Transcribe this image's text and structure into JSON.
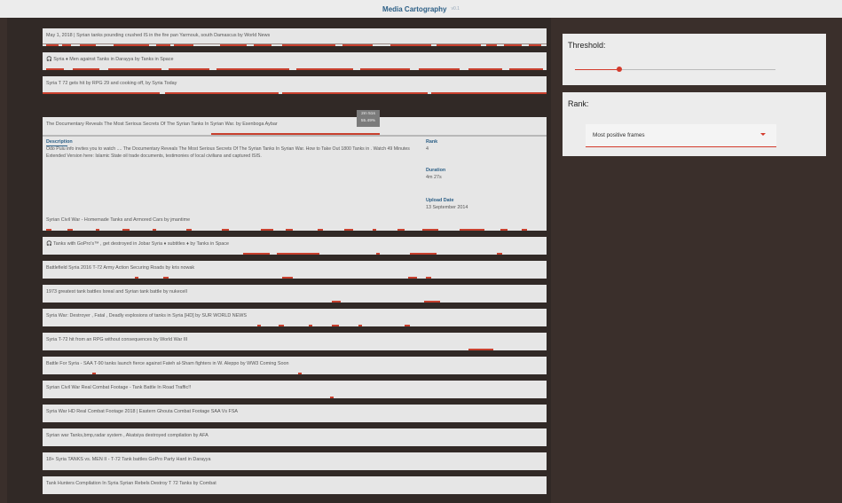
{
  "app": {
    "title": "Media Cartography",
    "version": "v0.1"
  },
  "colors": {
    "accent": "#d33a2c",
    "link": "#2c5f86",
    "background": "#3a2f2b"
  },
  "videos": [
    {
      "title": "May 1, 2018 | Syrian tanks pounding crushed IS in the fire pan Yarmouk, south Damascus by World News"
    },
    {
      "title": "🎧 Syria ♦ Men against Tanks in Darayya by Tanks in Space"
    },
    {
      "title": "Syria T 72 gets hit by RPG 29 and cooking off, by Syria Today"
    },
    {
      "title": "Syrian Civil War - Homemade Tanks and Armored Cars by jmantime"
    },
    {
      "title": "🎧 Tanks with GoPro's™ , get destroyed in Jobar Syria ♦ subtitles ♦ by Tanks in Space"
    },
    {
      "title": "Battlefield Syria 2016 T-72 Army Action Securing Roads by kris nowak"
    },
    {
      "title": "1973 greatest tank battles Isreal and Syrian tank battle by nukecell"
    },
    {
      "title": "Syria War: Destroyer , Fatal , Deadly explosions of tanks in Syria [HD] by SUR WORLD NEWS"
    },
    {
      "title": "Syria T-72 hit from an RPG without consequences by World War III"
    },
    {
      "title": "Battle For Syria - SAA T-90 tanks launch fierce against Fateh al-Sham fighters in W. Aleppo by WW3 Coming Soon"
    },
    {
      "title": "Syrian Civil War Real Combat Footage - Tank Battle In Road Traffic!!"
    },
    {
      "title": "Syria War HD Real Combat Footage 2018 | Eastern Ghouta Combat Footage SAA Vs FSA"
    },
    {
      "title": "Syrian war Tanks,bmp,radar system , Akatsiya destroyed compilation by AFA"
    },
    {
      "title": "18+ Syria TANKS vs. MEN II - T-72 Tank battles GoPro Party Hard in Darayya"
    },
    {
      "title": "Tank Hunters Compilation In Syria Syrian Rebels Destroy T 72 Tanks by Combat"
    }
  ],
  "expanded": {
    "title": "The Documentary Reveals The Most Serious Secrets Of The Syrian Tanks In Syrian War. by Esenboga Aybar",
    "tooltip_time": "2m 51s",
    "tooltip_percent": "55.49%",
    "progress": 0.5549,
    "description_label": "Description",
    "description": "Odo Puiu info invites you to watch .... The Documentary Reveals The Most Serious Secrets Of The Syrian Tanks In Syrian War. How to Take Out 1800 Tanks in . Watch 49 Minutes Extended Version here: Islamic State oil trade documents, testimonies of local civilians and captured ISIS.",
    "rank_label": "Rank",
    "rank": "4",
    "duration_label": "Duration",
    "duration": "4m 27s",
    "upload_label": "Upload Date",
    "upload_date": "13 September 2014"
  },
  "threshold": {
    "label": "Threshold:",
    "value": 0.22
  },
  "rank_panel": {
    "label": "Rank:",
    "selected": "Most positive frames"
  }
}
